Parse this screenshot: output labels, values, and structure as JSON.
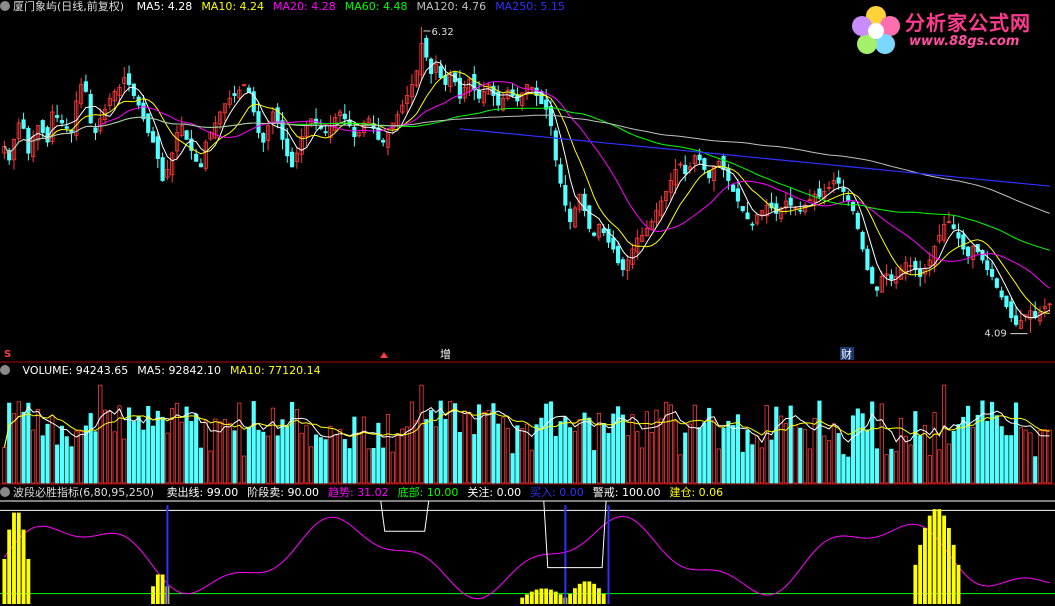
{
  "colors": {
    "up": "#ff3c3c",
    "down": "#54ffff",
    "ma5": "#ffffff",
    "ma10": "#ffff00",
    "ma20": "#ff00ff",
    "ma60": "#00ff00",
    "ma120": "#c0c0c0",
    "ma250": "#3030ff",
    "frame": "#b00000",
    "logo": "#ff3b8e"
  },
  "price_header": {
    "title": "厦门象屿(日线,前复权)",
    "items": [
      {
        "label": "MA5: 4.28",
        "color": "#ffffff"
      },
      {
        "label": "MA10: 4.24",
        "color": "#ffff00"
      },
      {
        "label": "MA20: 4.28",
        "color": "#ff00ff"
      },
      {
        "label": "MA60: 4.48",
        "color": "#00ff00"
      },
      {
        "label": "MA120: 4.76",
        "color": "#c0c0c0"
      },
      {
        "label": "MA250: 5.15",
        "color": "#3030ff"
      }
    ]
  },
  "volume_header": {
    "items": [
      {
        "label": "VOLUME: 94243.65",
        "color": "#ffffff"
      },
      {
        "label": "MA5: 92842.10",
        "color": "#ffffff"
      },
      {
        "label": "MA10: 77120.14",
        "color": "#ffff00"
      }
    ]
  },
  "indicator_header": {
    "title": "波段必胜指标(6,80,95,250)",
    "items": [
      {
        "label": "卖出线: 99.00",
        "color": "#ffffff"
      },
      {
        "label": "阶段卖: 90.00",
        "color": "#ffffff"
      },
      {
        "label": "趋势: 31.02",
        "color": "#ff00ff"
      },
      {
        "label": "底部: 10.00",
        "color": "#00ff00"
      },
      {
        "label": "关注: 0.00",
        "color": "#ffffff"
      },
      {
        "label": "买入: 0.00",
        "color": "#3030ff"
      },
      {
        "label": "警戒: 100.00",
        "color": "#ffffff"
      },
      {
        "label": "建仓: 0.06",
        "color": "#ffff00"
      }
    ]
  },
  "markers": {
    "high_label": "6.32",
    "low_label": "4.09",
    "event_s": "S",
    "event_zeng": "增",
    "event_cai": "财"
  },
  "logo": {
    "title": "分析家公式网",
    "url": "www.88gs.com"
  },
  "chart_data": [
    {
      "type": "candlestick",
      "title": "厦门象屿(日线,前复权)",
      "high": 6.32,
      "low": 4.09,
      "ylim": [
        4.0,
        6.4
      ],
      "series": [
        {
          "name": "MA5",
          "last": 4.28
        },
        {
          "name": "MA10",
          "last": 4.24
        },
        {
          "name": "MA20",
          "last": 4.28
        },
        {
          "name": "MA60",
          "last": 4.48
        },
        {
          "name": "MA120",
          "last": 4.76
        },
        {
          "name": "MA250",
          "last": 5.15
        }
      ],
      "close": [
        5.45,
        5.35,
        5.5,
        5.62,
        5.58,
        5.4,
        5.52,
        5.6,
        5.55,
        5.48,
        5.7,
        5.66,
        5.62,
        5.58,
        5.55,
        5.78,
        5.9,
        5.85,
        5.62,
        5.55,
        5.65,
        5.72,
        5.8,
        5.85,
        5.88,
        5.95,
        5.9,
        5.82,
        5.75,
        5.65,
        5.55,
        5.48,
        5.36,
        5.2,
        5.28,
        5.4,
        5.55,
        5.6,
        5.5,
        5.42,
        5.34,
        5.3,
        5.48,
        5.55,
        5.62,
        5.7,
        5.76,
        5.8,
        5.82,
        5.86,
        5.9,
        5.84,
        5.7,
        5.55,
        5.48,
        5.6,
        5.7,
        5.62,
        5.5,
        5.38,
        5.3,
        5.4,
        5.52,
        5.6,
        5.65,
        5.62,
        5.58,
        5.55,
        5.6,
        5.66,
        5.7,
        5.65,
        5.6,
        5.52,
        5.55,
        5.62,
        5.65,
        5.58,
        5.5,
        5.48,
        5.55,
        5.62,
        5.68,
        5.75,
        5.82,
        5.9,
        6.0,
        6.2,
        6.1,
        5.98,
        6.05,
        5.95,
        5.9,
        5.98,
        5.92,
        5.8,
        5.88,
        5.94,
        5.86,
        5.8,
        5.85,
        5.9,
        5.82,
        5.75,
        5.8,
        5.86,
        5.82,
        5.78,
        5.84,
        5.9,
        5.88,
        5.82,
        5.76,
        5.72,
        5.6,
        5.35,
        5.18,
        5.02,
        4.9,
        5.0,
        5.1,
        4.98,
        4.85,
        4.8,
        4.88,
        4.82,
        4.75,
        4.7,
        4.6,
        4.55,
        4.62,
        4.7,
        4.78,
        4.8,
        4.85,
        4.9,
        4.98,
        5.05,
        5.12,
        5.2,
        5.28,
        5.32,
        5.25,
        5.3,
        5.38,
        5.35,
        5.28,
        5.22,
        5.3,
        5.34,
        5.28,
        5.2,
        5.12,
        5.05,
        4.98,
        4.92,
        4.88,
        4.95,
        4.98,
        5.02,
        5.0,
        4.96,
        5.0,
        5.05,
        5.02,
        5.0,
        4.98,
        5.02,
        5.06,
        5.1,
        5.08,
        5.12,
        5.15,
        5.2,
        5.18,
        5.12,
        5.05,
        4.98,
        4.85,
        4.7,
        4.55,
        4.45,
        4.4,
        4.5,
        4.52,
        4.48,
        4.5,
        4.55,
        4.6,
        4.58,
        4.55,
        4.5,
        4.56,
        4.62,
        4.72,
        4.8,
        4.88,
        4.9,
        4.85,
        4.78,
        4.7,
        4.65,
        4.72,
        4.68,
        4.62,
        4.55,
        4.5,
        4.42,
        4.35,
        4.28,
        4.2,
        4.15,
        4.18,
        4.22,
        4.25,
        4.2,
        4.24,
        4.28,
        4.3
      ]
    },
    {
      "type": "bar",
      "title": "VOLUME",
      "series": [
        {
          "name": "VOLUME",
          "last": 94243.65
        },
        {
          "name": "MA5",
          "last": 92842.1
        },
        {
          "name": "MA10",
          "last": 77120.14
        }
      ]
    },
    {
      "type": "line",
      "title": "波段必胜指标(6,80,95,250)",
      "series": [
        {
          "name": "卖出线",
          "last": 99.0
        },
        {
          "name": "阶段卖",
          "last": 90.0
        },
        {
          "name": "趋势",
          "last": 31.02
        },
        {
          "name": "底部",
          "last": 10.0
        },
        {
          "name": "关注",
          "last": 0.0
        },
        {
          "name": "买入",
          "last": 0.0
        },
        {
          "name": "警戒",
          "last": 100.0
        },
        {
          "name": "建仓",
          "last": 0.06
        }
      ]
    }
  ]
}
